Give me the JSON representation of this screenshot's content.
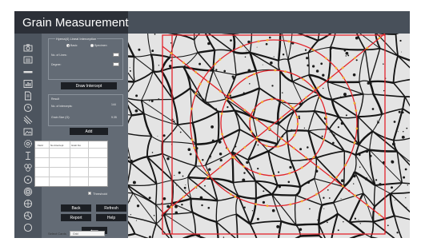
{
  "app": {
    "title": "Grain Measurement"
  },
  "toolbar": {
    "icons": [
      "camera-icon",
      "ruler-icon",
      "bar-icon",
      "histogram-icon",
      "document-icon",
      "circle-icon",
      "diagonal-lines-icon",
      "image-icon",
      "settings-icon",
      "i-beam-icon",
      "grains-icon",
      "target-icon",
      "concentric-icon",
      "crosshair-icon",
      "hand-icon",
      "ring-icon"
    ]
  },
  "panel": {
    "group_title": "Hyena(4) Lineal Interception",
    "radio_a": "Basic",
    "radio_b": "Specimen",
    "lines_label": "No. of Lines:",
    "degree_label": "Degree:",
    "draw_button": "Draw Intercept",
    "result_title": "Result",
    "intercepts_label": "No. of intercepts:",
    "intercepts_value": "144",
    "grain_size_label": "Grain Size (G):",
    "grain_size_value": "9.35",
    "add_button": "Add",
    "table_headers": [
      "Field",
      "No.Intercept",
      "Grain No"
    ],
    "threshold_label": "Threshold",
    "back_button": "Back",
    "refresh_button": "Refresh",
    "report_button": "Report",
    "help_button": "Help",
    "arrow_button": "⟵",
    "select_card_label": "Select Cards",
    "select_card_value": "Grid"
  },
  "colors": {
    "accent_red": "#e3242b",
    "intercept_marker": "#f2b233",
    "toolbar_bg": "#4c545e",
    "panel_bg": "#636b75",
    "button_bg": "#1c1f24"
  }
}
